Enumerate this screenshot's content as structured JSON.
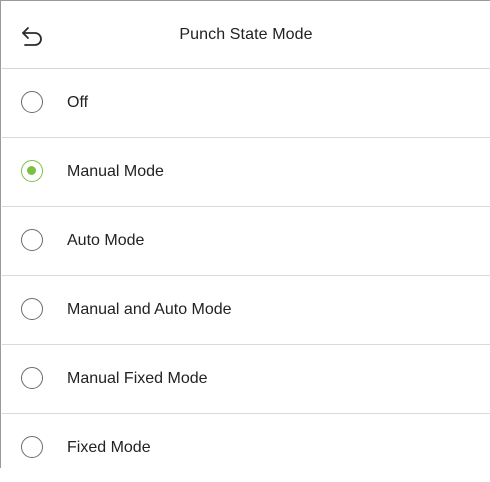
{
  "header": {
    "title": "Punch State Mode",
    "back_icon": "back-arrow-icon"
  },
  "options": [
    {
      "label": "Off",
      "selected": false
    },
    {
      "label": "Manual Mode",
      "selected": true
    },
    {
      "label": "Auto Mode",
      "selected": false
    },
    {
      "label": "Manual and Auto Mode",
      "selected": false
    },
    {
      "label": "Manual Fixed Mode",
      "selected": false
    },
    {
      "label": "Fixed Mode",
      "selected": false
    }
  ],
  "colors": {
    "accent": "#7ac143",
    "radio_border": "#6b6b6b",
    "divider": "#d9d9d9"
  }
}
